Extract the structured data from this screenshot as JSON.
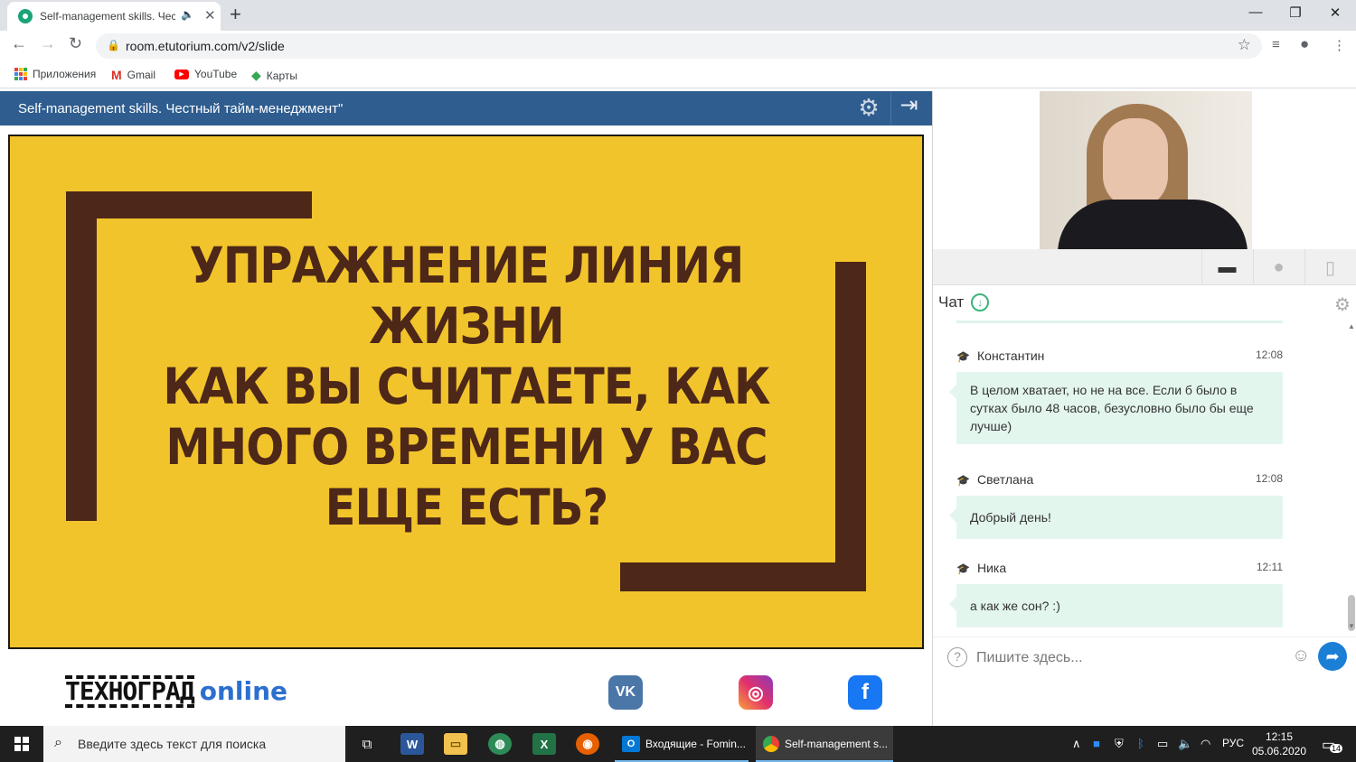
{
  "browser": {
    "tab_title": "Self-management skills. Чест",
    "url": "room.etutorium.com/v2/slide",
    "bookmarks": [
      "Приложения",
      "Gmail",
      "YouTube",
      "Карты"
    ]
  },
  "slide_header": {
    "title": "Self-management skills. Честный тайм-менеджмент\""
  },
  "slide": {
    "lines": [
      "УПРАЖНЕНИЕ ЛИНИЯ",
      "ЖИЗНИ",
      "КАК ВЫ СЧИТАЕТЕ, КАК",
      "МНОГО ВРЕМЕНИ У ВАС",
      "ЕЩЕ ЕСТЬ?"
    ],
    "background_color": "#f2c42c",
    "text_color": "#4d2718"
  },
  "footer": {
    "logo_text": "ТЕХНОГРАД",
    "logo_accent": "online",
    "social": [
      "vk-icon",
      "instagram-icon",
      "facebook-icon"
    ]
  },
  "chat": {
    "heading": "Чат",
    "messages": [
      {
        "name": "Константин",
        "time": "12:08",
        "text": "В целом хватает, но не на все. Если б было в сутках было 48 часов, безусловно было бы еще лучше)"
      },
      {
        "name": "Светлана",
        "time": "12:08",
        "text": "Добрый день!"
      },
      {
        "name": "Ника",
        "time": "12:11",
        "text": "а как же сон? :)"
      }
    ],
    "input_placeholder": "Пишите здесь..."
  },
  "taskbar": {
    "search_placeholder": "Введите здесь текст для поиска",
    "apps": [
      {
        "label": "Входящие - Fomin...",
        "icon": "outlook-icon"
      },
      {
        "label": "Self-management s...",
        "icon": "chrome-icon"
      }
    ],
    "language": "РУС",
    "time": "12:15",
    "date": "05.06.2020",
    "notifications": "14"
  }
}
